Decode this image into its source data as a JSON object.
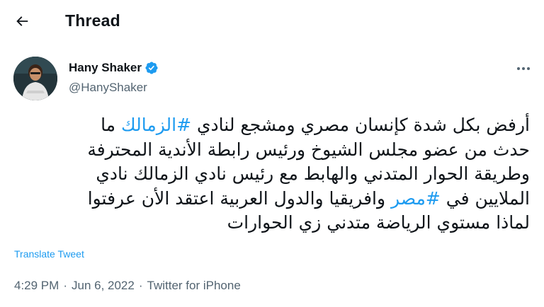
{
  "header": {
    "title": "Thread",
    "back_icon": "arrow-left-icon"
  },
  "author": {
    "name": "Hany Shaker",
    "handle": "@HanyShaker",
    "verified_icon": "verified-badge-icon",
    "verified_color": "#1d9bf0"
  },
  "tweet": {
    "lines": [
      {
        "parts": [
          {
            "text": "أرفض بكل شدة كإنسان مصري ومشجع لنادي ",
            "hashtag": false
          },
          {
            "text": "#الزمالك",
            "hashtag": true
          },
          {
            "text": " ما",
            "hashtag": false
          }
        ]
      },
      {
        "parts": [
          {
            "text": "حدث من عضو مجلس الشيوخ ورئيس رابطة الأندية المحترفة",
            "hashtag": false
          }
        ]
      },
      {
        "parts": [
          {
            "text": "وطريقة الحوار المتدني والهابط مع رئيس نادي الزمالك نادي",
            "hashtag": false
          }
        ]
      },
      {
        "parts": [
          {
            "text": "الملايين في ",
            "hashtag": false
          },
          {
            "text": "#مصر",
            "hashtag": true
          },
          {
            "text": " وافريقيا والدول العربية اعتقد الأن عرفتوا",
            "hashtag": false
          }
        ]
      },
      {
        "parts": [
          {
            "text": "لماذا مستوي الرياضة متدني زي الحوارات",
            "hashtag": false
          }
        ]
      }
    ],
    "translate_label": "Translate Tweet"
  },
  "meta": {
    "time": "4:29 PM",
    "separator": "·",
    "date": "Jun 6, 2022",
    "source": "Twitter for iPhone"
  },
  "more_icon": "more-horizontal-icon",
  "colors": {
    "accent": "#1d9bf0",
    "text": "#0f1419",
    "secondary": "#536471"
  }
}
